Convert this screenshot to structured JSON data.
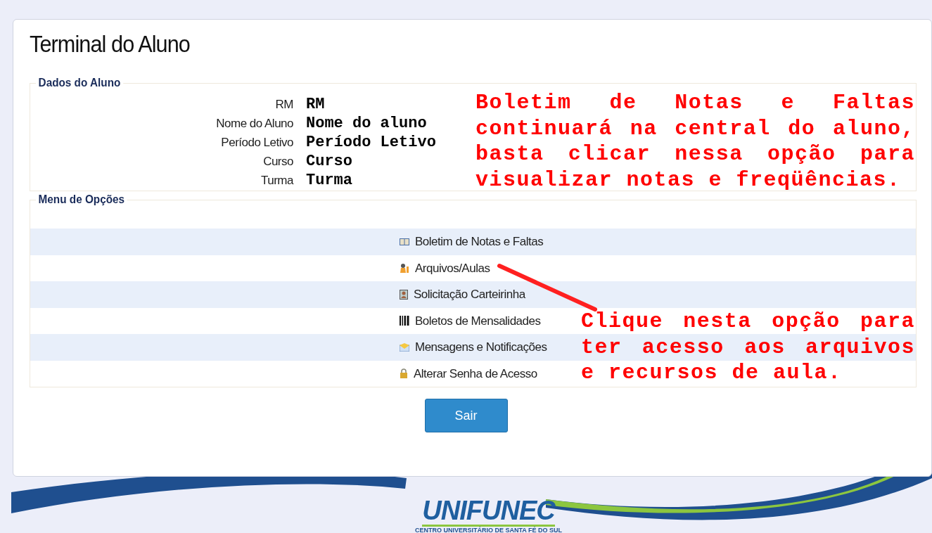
{
  "page": {
    "title": "Terminal do Aluno"
  },
  "student_section": {
    "legend": "Dados do Aluno",
    "fields": [
      {
        "label": "RM",
        "value": "RM"
      },
      {
        "label": "Nome do Aluno",
        "value": "Nome do aluno"
      },
      {
        "label": "Período Letivo",
        "value": "Período Letivo"
      },
      {
        "label": "Curso",
        "value": "Curso"
      },
      {
        "label": "Turma",
        "value": "Turma"
      }
    ]
  },
  "menu_section": {
    "legend": "Menu de Opções",
    "items": [
      {
        "label": "Boletim de Notas e Faltas"
      },
      {
        "label": "Arquivos/Aulas"
      },
      {
        "label": "Solicitação Carteirinha"
      },
      {
        "label": "Boletos de Mensalidades"
      },
      {
        "label": "Mensagens e Notificações"
      },
      {
        "label": "Alterar Senha de Acesso"
      }
    ]
  },
  "exit_button": "Sair",
  "annotations": [
    {
      "text": "Boletim de Notas e Faltas continuará na central do aluno, basta clicar nessa opção para visualizar notas e freqüências."
    },
    {
      "text": "Clique nesta opção para ter acesso aos arquivos e recursos de aula."
    }
  ],
  "footer_logo": {
    "name": "UNIFUNEC",
    "subtitle": "CENTRO UNIVERSITÁRIO DE SANTA FÉ DO SUL"
  }
}
